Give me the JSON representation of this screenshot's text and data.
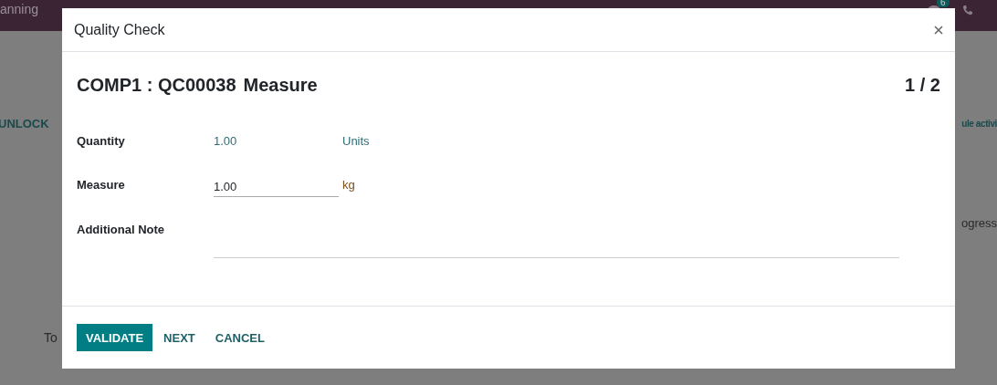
{
  "navbar": {
    "menu": [
      "anning"
    ],
    "messages_badge": "6"
  },
  "background": {
    "left_button": "UNLOCK",
    "left_label": "To",
    "right_link": "ule activi",
    "right_status": "ogress"
  },
  "dialog": {
    "title": "Quality Check",
    "heading": {
      "product": "COMP1 : QC00038",
      "step": "Measure",
      "counter": "1 / 2"
    },
    "fields": [
      {
        "kind": "readonly",
        "label": "Quantity",
        "value": "1.00",
        "unit": "Units"
      },
      {
        "kind": "input",
        "label": "Measure",
        "value": "1.00",
        "unit": "kg"
      },
      {
        "kind": "textarea",
        "label": "Additional Note"
      }
    ],
    "buttons": [
      {
        "label": "VALIDATE",
        "primary": true
      },
      {
        "label": "NEXT",
        "primary": false
      },
      {
        "label": "CANCEL",
        "primary": false
      }
    ]
  }
}
